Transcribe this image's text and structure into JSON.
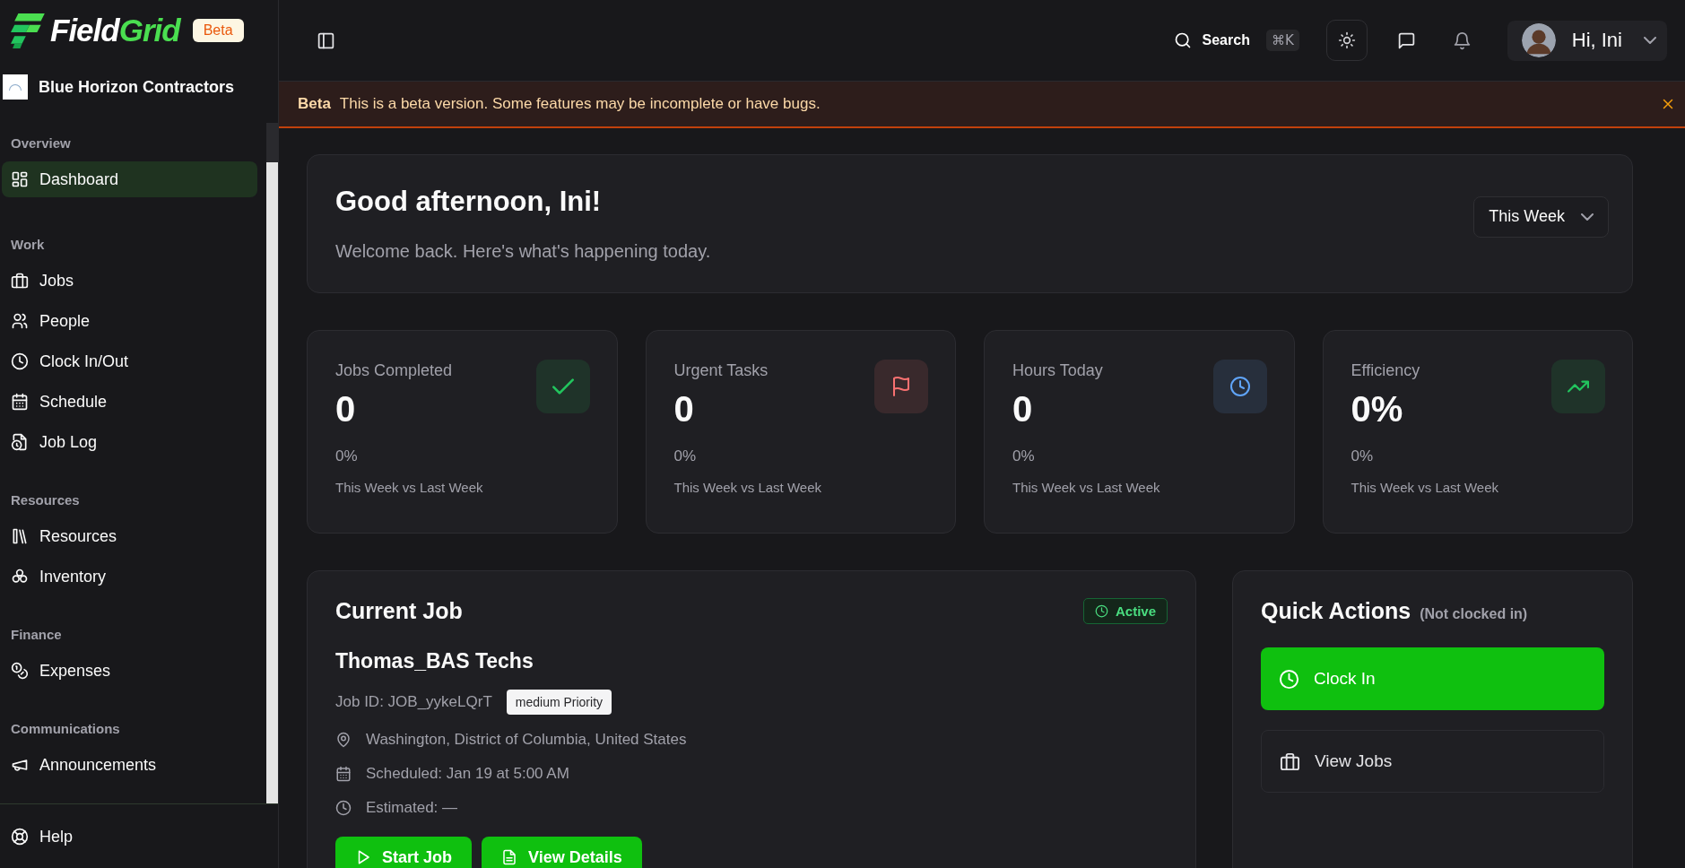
{
  "sidebar": {
    "logo": {
      "part_1": "Field",
      "part_2": "Grid"
    },
    "badge": "Beta",
    "company": "Blue Horizon Contractors",
    "sections": [
      {
        "heading": "Overview",
        "items": [
          {
            "label": "Dashboard",
            "kind": "dashboard",
            "selected": true
          }
        ]
      },
      {
        "heading": "Work",
        "items": [
          {
            "label": "Jobs",
            "kind": "jobs",
            "selected": false
          },
          {
            "label": "People",
            "kind": "people",
            "selected": false
          },
          {
            "label": "Clock In/Out",
            "kind": "clock",
            "selected": false
          },
          {
            "label": "Schedule",
            "kind": "schedule",
            "selected": false
          },
          {
            "label": "Job Log",
            "kind": "log",
            "selected": false
          }
        ]
      },
      {
        "heading": "Resources",
        "items": [
          {
            "label": "Resources",
            "kind": "resources",
            "selected": false
          },
          {
            "label": "Inventory",
            "kind": "inventory",
            "selected": false
          }
        ]
      },
      {
        "heading": "Finance",
        "items": [
          {
            "label": "Expenses",
            "kind": "expenses",
            "selected": false
          }
        ]
      },
      {
        "heading": "Communications",
        "items": [
          {
            "label": "Announcements",
            "kind": "announcements",
            "selected": false
          }
        ]
      }
    ],
    "footer_items": [
      {
        "label": "Help",
        "kind": "help",
        "selected": false
      }
    ]
  },
  "topbar": {
    "search_label": "Search",
    "shortcut": "⌘K",
    "greeting": "Hi, Ini"
  },
  "banner": {
    "tag": "Beta",
    "message": "This is a beta version. Some features may be incomplete or have bugs."
  },
  "welcome": {
    "title": "Good afternoon, Ini!",
    "subtitle": "Welcome back. Here's what's happening today.",
    "period": "This Week"
  },
  "stats": [
    {
      "label": "Jobs Completed",
      "value": "0",
      "change": "0%",
      "comparison": "This Week vs Last Week",
      "kind": "completed",
      "color": "#22c55e"
    },
    {
      "label": "Urgent Tasks",
      "value": "0",
      "change": "0%",
      "comparison": "This Week vs Last Week",
      "kind": "urgent",
      "color": "#f87171"
    },
    {
      "label": "Hours Today",
      "value": "0",
      "change": "0%",
      "comparison": "This Week vs Last Week",
      "kind": "hours",
      "color": "#60a5fa"
    },
    {
      "label": "Efficiency",
      "value": "0%",
      "change": "0%",
      "comparison": "This Week vs Last Week",
      "kind": "efficiency",
      "color": "#22c55e"
    }
  ],
  "current_job": {
    "title": "Current Job",
    "status": "Active",
    "name": "Thomas_BAS Techs",
    "job_id": "Job ID: JOB_yykeLQrT",
    "priority": "medium Priority",
    "details": [
      {
        "kind": "location",
        "text": "Washington, District of Columbia, United States"
      },
      {
        "kind": "schedule",
        "text": "Scheduled: Jan 19 at 5:00 AM"
      },
      {
        "kind": "estimate",
        "text": "Estimated: —"
      }
    ],
    "buttons": [
      {
        "label": "Start Job",
        "kind": "start"
      },
      {
        "label": "View Details",
        "kind": "details"
      }
    ]
  },
  "quick_actions": {
    "title": "Quick Actions",
    "note": "(Not clocked in)",
    "buttons": [
      {
        "label": "Clock In",
        "kind": "primary"
      },
      {
        "label": "View Jobs",
        "kind": "secondary"
      }
    ]
  }
}
